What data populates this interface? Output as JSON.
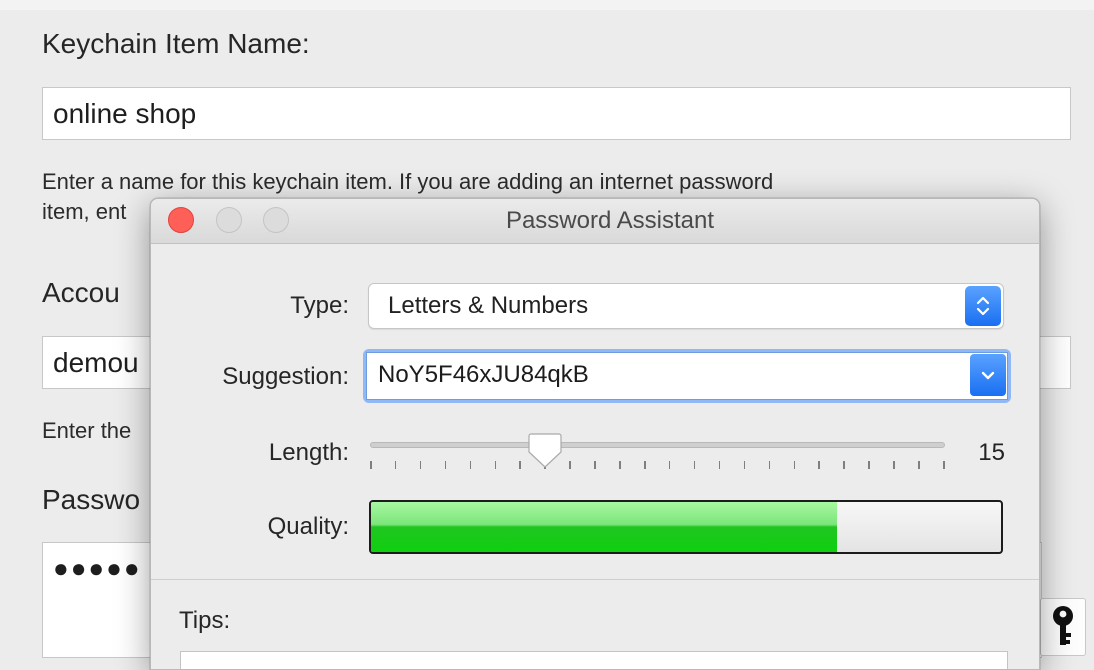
{
  "background_form": {
    "item_name_label": "Keychain Item Name:",
    "item_name_value": "online shop",
    "item_name_hint_line1": "Enter a name for this keychain item. If you are adding an internet password",
    "item_name_hint_line2": "item, ent",
    "account_label": "Accou",
    "account_value": "demou",
    "account_hint": "Enter the",
    "password_label": "Passwo",
    "password_value": "●●●●●",
    "key_icon": "key-icon"
  },
  "dialog": {
    "title": "Password Assistant",
    "type": {
      "label": "Type:",
      "selected": "Letters & Numbers"
    },
    "suggestion": {
      "label": "Suggestion:",
      "value": "NoY5F46xJU84qkB"
    },
    "length": {
      "label": "Length:",
      "value": 15,
      "min": 8,
      "max": 31,
      "value_text": "15"
    },
    "quality": {
      "label": "Quality:",
      "fraction": 0.74
    },
    "tips": {
      "label": "Tips:"
    }
  },
  "colors": {
    "close_button": "#fe5f57",
    "accent_blue": "#1a6ff2",
    "quality_green": "#0fd00f"
  }
}
